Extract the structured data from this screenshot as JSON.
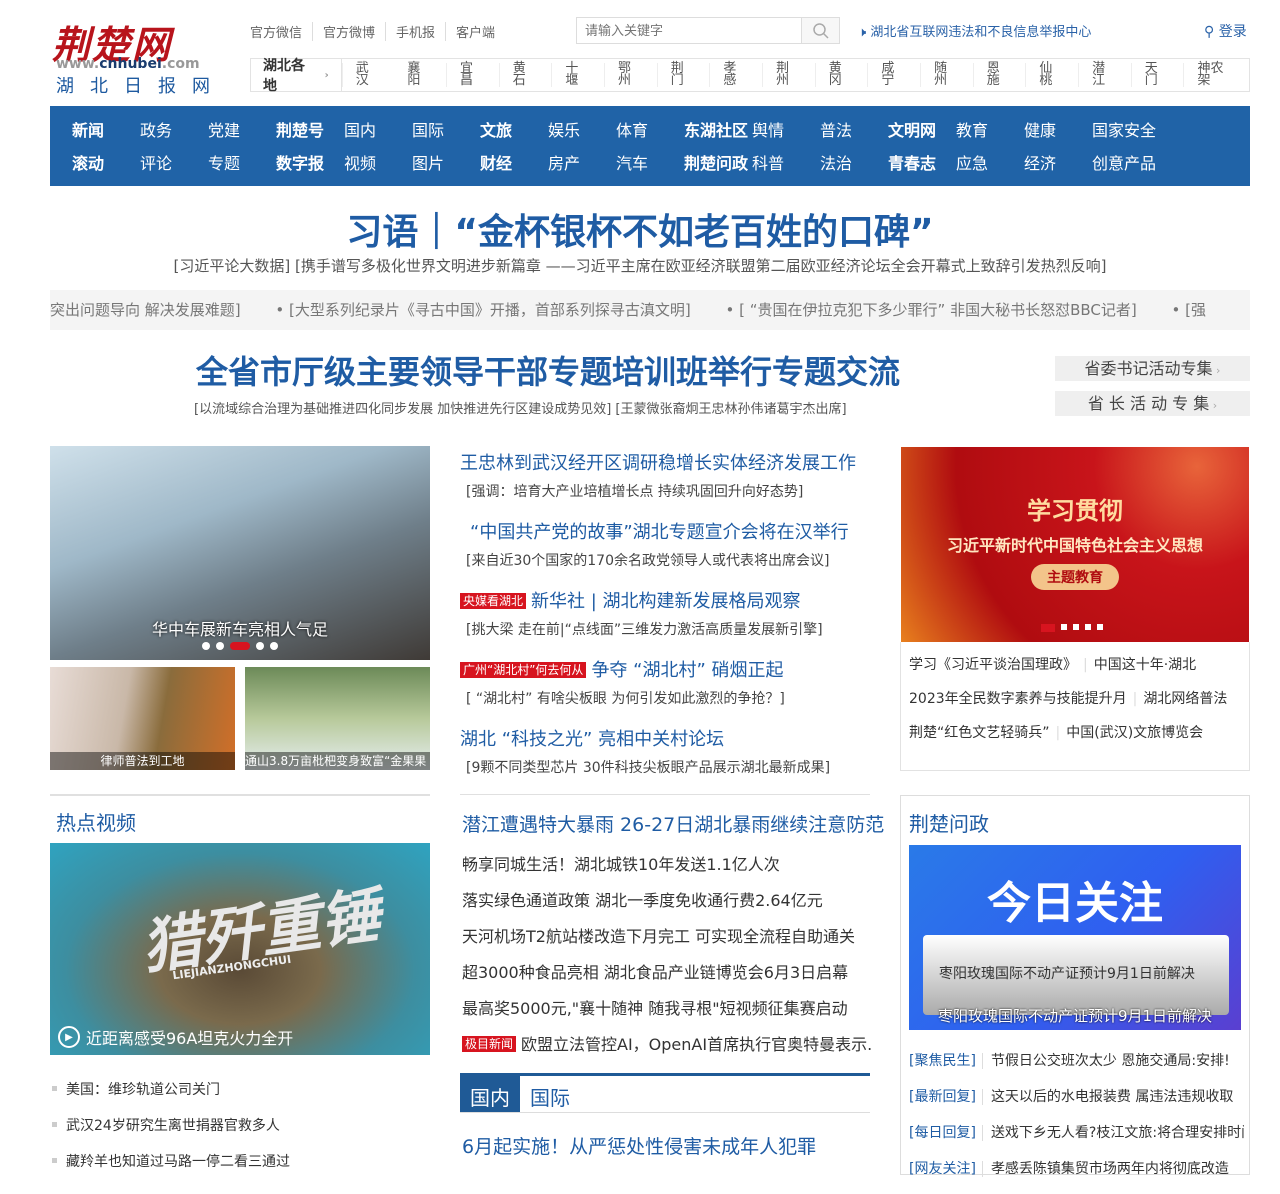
{
  "logo": {
    "name": "荆楚网",
    "url_pre": "www.",
    "url_main": "cnhubei",
    ".com": ".com",
    "sub": "湖北日报网"
  },
  "toplinks": [
    "官方微信",
    "官方微博",
    "手机报",
    "客户端"
  ],
  "search": {
    "placeholder": "请输入关键字"
  },
  "report": "湖北省互联网违法和不良信息举报中心",
  "login": "登录",
  "region": {
    "title": "湖北各地",
    "items": [
      "武汉",
      "襄阳",
      "宜昌",
      "黄石",
      "十堰",
      "鄂州",
      "荆门",
      "孝感",
      "荆州",
      "黄冈",
      "咸宁",
      "随州",
      "恩施",
      "仙桃",
      "潜江",
      "天门",
      "神农架"
    ]
  },
  "nav": {
    "row1": [
      "新闻",
      "政务",
      "党建",
      "荆楚号",
      "国内",
      "国际",
      "文旅",
      "娱乐",
      "体育",
      "东湖社区",
      "舆情",
      "普法",
      "文明网",
      "教育",
      "健康",
      "国家安全"
    ],
    "row2": [
      "滚动",
      "评论",
      "专题",
      "数字报",
      "视频",
      "图片",
      "财经",
      "房产",
      "汽车",
      "荆楚问政",
      "科普",
      "法治",
      "青春志",
      "应急",
      "经济",
      "创意产品"
    ]
  },
  "headline": {
    "title": "习语｜“金杯银杯不如老百姓的口碑”",
    "sub": "[习近平论大数据]  [携手谱写多极化世界文明进步新篇章 ——习近平主席在欧亚经济联盟第二届欧亚经济论坛全会开幕式上致辞引发热烈反响]"
  },
  "ticker": [
    "突出问题导向 解决发展难题]",
    "• [大型系列纪录片《寻古中国》开播，首部系列探寻古滇文明]",
    "• [ “贵国在伊拉克犯下多少罪行” 非国大秘书长怒怼BBC记者]",
    "• [强"
  ],
  "headline2": {
    "title": "全省市厅级主要领导干部专题培训班举行专题交流",
    "sub": "[以流域综合治理为基础推进四化同步发展 加快推进先行区建设成势见效]   [王蒙微张裔炯王忠林孙伟诸葛宇杰出席]"
  },
  "special": [
    "省委书记活动专集",
    "省 长 活 动 专 集"
  ],
  "slider": {
    "caption": "华中车展新车亮相人气足",
    "thumbs": [
      "律师普法到工地",
      "通山3.8万亩枇杷变身致富“金果果"
    ]
  },
  "news": [
    {
      "title": "王忠林到武汉经开区调研稳增长实体经济发展工作",
      "sub": "[强调：培育大产业培植增长点  持续巩固回升向好态势]"
    },
    {
      "title": "“中国共产党的故事”湖北专题宣介会将在汉举行",
      "sub": "[来自近30个国家的170余名政党领导人或代表将出席会议]"
    },
    {
      "tag": "央媒看湖北",
      "title": "新华社 | 湖北构建新发展格局观察",
      "sub": "[挑大梁  走在前|“点线面”三维发力激活高质量发展新引擎]"
    },
    {
      "tag": "广州“湖北村”何去何从",
      "title": "争夺 “湖北村” 硝烟正起",
      "sub": "[ “湖北村” 有啥尖板眼  为何引发如此激烈的争抢？]"
    },
    {
      "title": "湖北 “科技之光” 亮相中关村论坛",
      "sub": "[9颗不同类型芯片  30件科技尖板眼产品展示湖北最新成果]"
    }
  ],
  "banner": {
    "l1": "学习贯彻",
    "l2": "习近平新时代中国特色社会主义思想",
    "btn": "主题教育"
  },
  "rlinks": [
    [
      "学习《习近平谈治国理政》",
      "中国这十年·湖北"
    ],
    [
      "2023年全民数字素养与技能提升月",
      "湖北网络普法"
    ],
    [
      "荆楚“红色文艺轻骑兵”",
      "中国(武汉)文旅博览会"
    ]
  ],
  "video": {
    "title": "热点视频",
    "caption": "近距离感受96A坦克火力全开",
    "art": "猎歼重锤",
    "art_en": "LIEJIANZHONGCHUI",
    "list": [
      "美国：维珍轨道公司关门",
      "武汉24岁研究生离世捐器官救多人",
      "藏羚羊也知道过马路一停二看三通过"
    ]
  },
  "mid2": {
    "lead": "潜江遭遇特大暴雨 26-27日湖北暴雨继续注意防范",
    "items": [
      "畅享同城生活！湖北城铁10年发送1.1亿人次",
      "落实绿色通道政策 湖北一季度免收通行费2.64亿元",
      "天河机场T2航站楼改造下月完工 可实现全流程自助通关",
      "超3000种食品亮相 湖北食品产业链博览会6月3日启幕",
      "最高奖5000元,\"襄十随神 随我寻根\"短视频征集赛启动"
    ],
    "tag": "极目新闻",
    "tagged": "欧盟立法管控AI，OpenAI首席执行官奥特曼表示.",
    "tabs": [
      "国内",
      "国际"
    ],
    "tab_lead": "6月起实施！从严惩处性侵害未成年人犯罪"
  },
  "wenzheng": {
    "title": "荆楚问政",
    "img_title": "今日关注",
    "img_card": "枣阳玫瑰国际不动产证预计9月1日前解决",
    "img_cap": "枣阳玫瑰国际不动产证预计9月1日前解决",
    "list": [
      [
        "[聚焦民生]",
        "节假日公交班次太少 恩施交通局:安排!"
      ],
      [
        "[最新回复]",
        "这天以后的水电报装费 属违法违规收取"
      ],
      [
        "[每日回复]",
        "送戏下乡无人看?枝江文旅:将合理安排时间"
      ],
      [
        "[网友关注]",
        "孝感丢陈镇集贸市场两年内将彻底改造"
      ]
    ]
  }
}
